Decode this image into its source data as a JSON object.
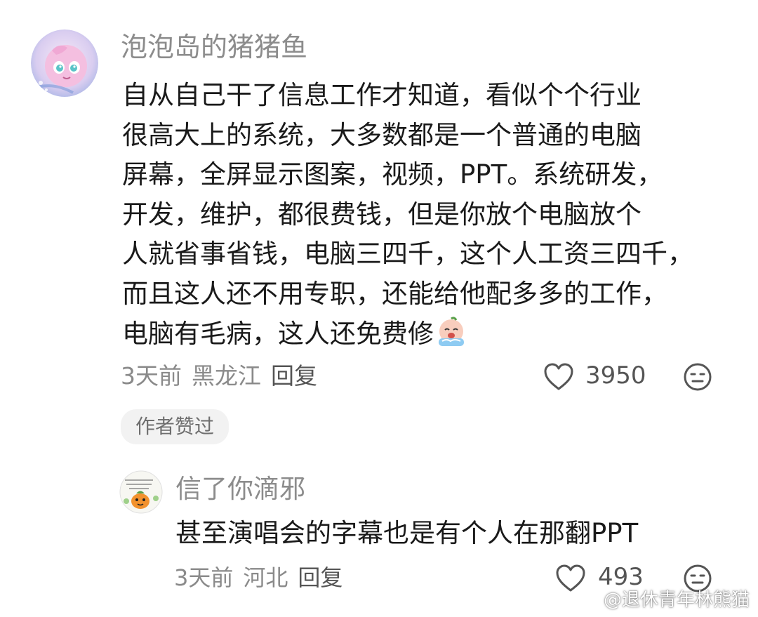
{
  "comments": [
    {
      "username": "泡泡岛的猪猪鱼",
      "lines": [
        "自从自己干了信息工作才知道，看似个个行业",
        "很高大上的系统，大多数都是一个普通的电脑",
        "屏幕，全屏显示图案，视频，PPT。系统研发，",
        "开发，维护，都很费钱，但是你放个电脑放个",
        "人就省事省钱，电脑三四千，这个人工资三四千，",
        "而且这人还不用专职，还能给他配多多的工作，",
        "电脑有毛病，这人还免费修"
      ],
      "time": "3天前",
      "location": "黑龙江",
      "reply_label": "回复",
      "likes": "3950",
      "badge": "作者赞过"
    },
    {
      "username": "信了你滴邪",
      "text": "甚至演唱会的字幕也是有个人在那翻PPT",
      "time": "3天前",
      "location": "河北",
      "reply_label": "回复",
      "likes": "493"
    }
  ],
  "watermark": "@退休青年林熊猫",
  "icons": [
    "heart-outline-icon",
    "emoji-reaction-icon",
    "crying-emoji-icon",
    "weibo-logo-icon"
  ],
  "colors": {
    "username": "#8c8c8c",
    "meta": "#8a8a8a",
    "text": "#1a1a1a",
    "badge_bg": "#f2f2f2"
  }
}
